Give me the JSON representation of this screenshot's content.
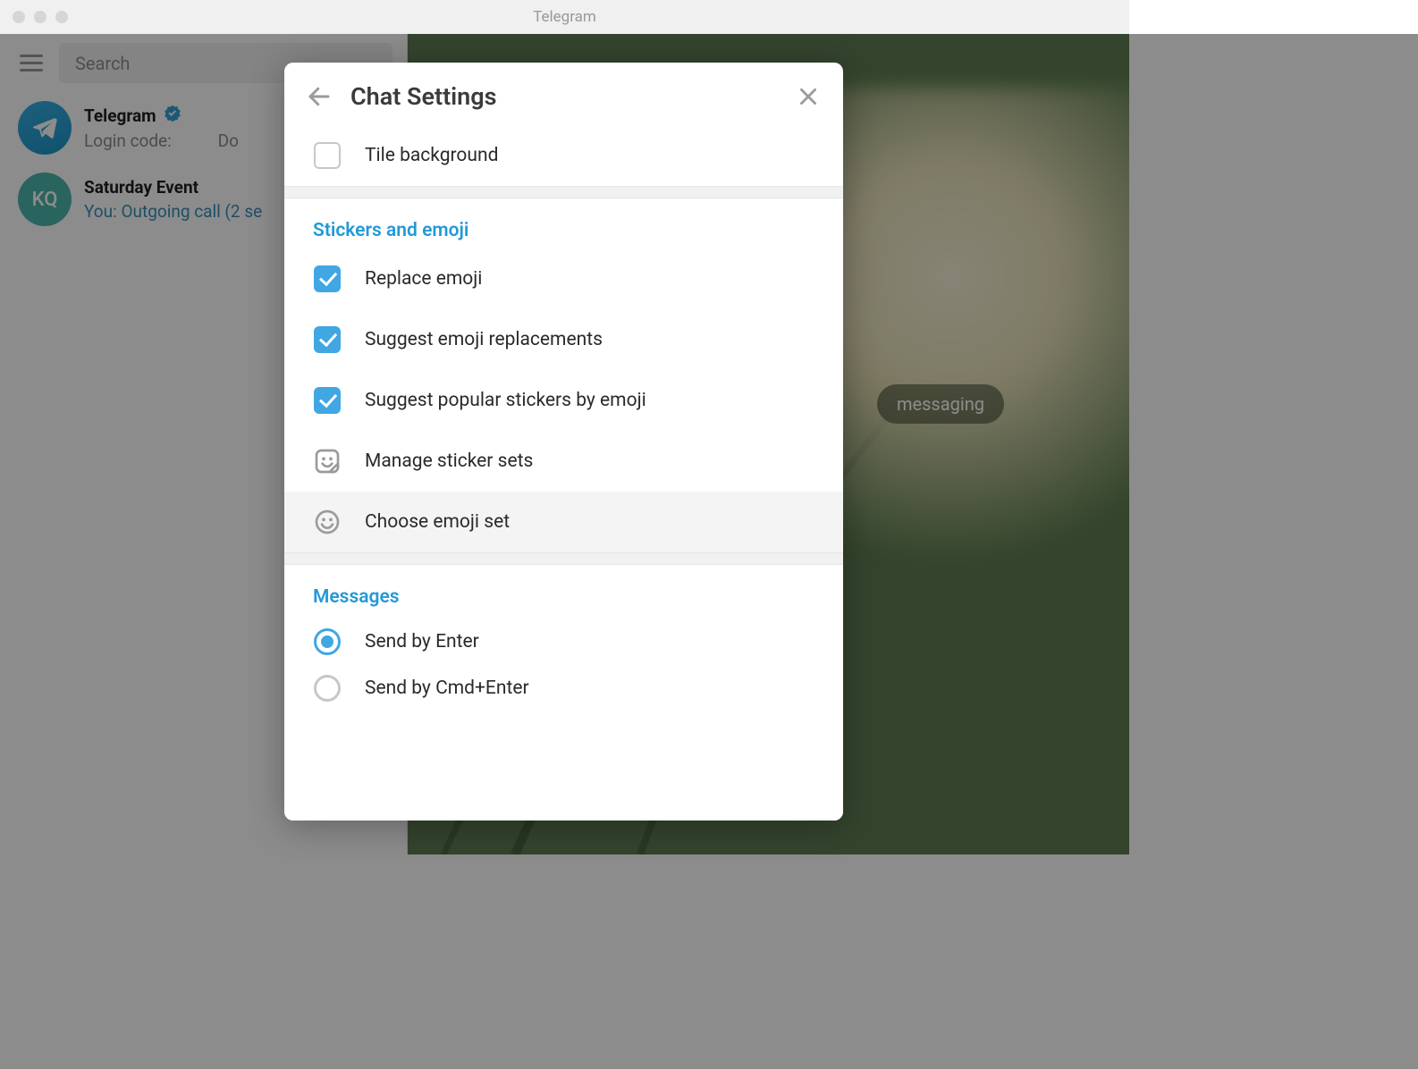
{
  "window": {
    "title": "Telegram"
  },
  "sidebar": {
    "search_placeholder": "Search",
    "chats": [
      {
        "name": "Telegram",
        "verified": true,
        "preview_plain": "Login code:",
        "preview_right": "Do",
        "avatar_letters": ""
      },
      {
        "name": "Saturday Event",
        "verified": false,
        "you_prefix": "You: ",
        "preview_rest": "Outgoing call (2 se",
        "avatar_letters": "KQ"
      }
    ]
  },
  "right_chip": "messaging",
  "dialog": {
    "title": "Chat Settings",
    "tile_background": {
      "label": "Tile background",
      "checked": false
    },
    "stickers_section": "Stickers and emoji",
    "replace_emoji": {
      "label": "Replace emoji",
      "checked": true
    },
    "suggest_replacements": {
      "label": "Suggest emoji replacements",
      "checked": true
    },
    "suggest_popular": {
      "label": "Suggest popular stickers by emoji",
      "checked": true
    },
    "manage_stickers": "Manage sticker sets",
    "choose_emoji_set": "Choose emoji set",
    "messages_section": "Messages",
    "send_enter": "Send by Enter",
    "send_cmd_enter": "Send by Cmd+Enter",
    "send_mode": "enter"
  }
}
